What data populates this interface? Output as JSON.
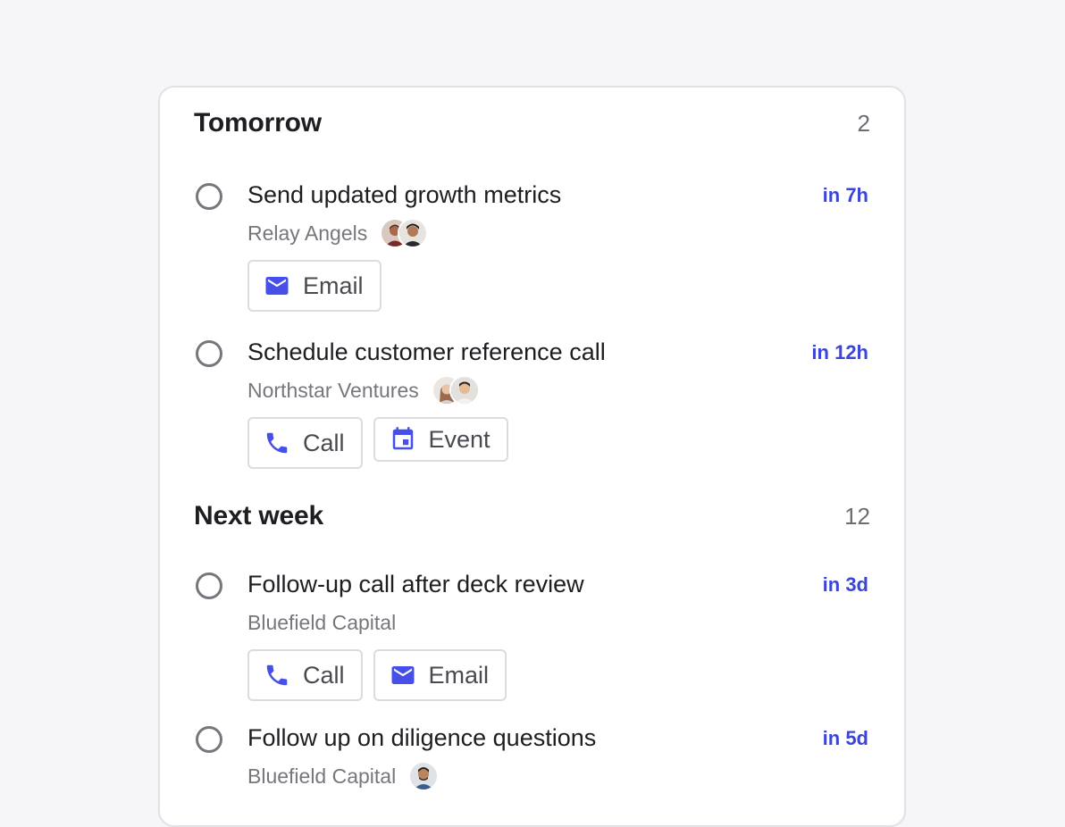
{
  "colors": {
    "accent": "#3b45d6",
    "icon": "#4650e8",
    "muted_text": "#77767c",
    "background": "#f6f5f8"
  },
  "sections": [
    {
      "title": "Tomorrow",
      "count": "2",
      "tasks": [
        {
          "title": "Send updated growth metrics",
          "due": "in 7h",
          "company": "Relay Angels",
          "avatars": [
            "avatar",
            "avatar"
          ],
          "actions": [
            {
              "label": "Email",
              "icon": "mail-icon"
            }
          ]
        },
        {
          "title": "Schedule customer reference call",
          "due": "in 12h",
          "company": "Northstar Ventures",
          "avatars": [
            "avatar",
            "avatar"
          ],
          "actions": [
            {
              "label": "Call",
              "icon": "phone-icon"
            },
            {
              "label": "Event",
              "icon": "calendar-icon"
            }
          ]
        }
      ]
    },
    {
      "title": "Next week",
      "count": "12",
      "tasks": [
        {
          "title": "Follow-up call after deck review",
          "due": "in 3d",
          "company": "Bluefield Capital",
          "avatars": [],
          "actions": [
            {
              "label": "Call",
              "icon": "phone-icon"
            },
            {
              "label": "Email",
              "icon": "mail-icon"
            }
          ]
        },
        {
          "title": "Follow up on diligence questions",
          "due": "in 5d",
          "company": "Bluefield Capital",
          "avatars": [
            "avatar"
          ],
          "actions": []
        }
      ]
    }
  ]
}
